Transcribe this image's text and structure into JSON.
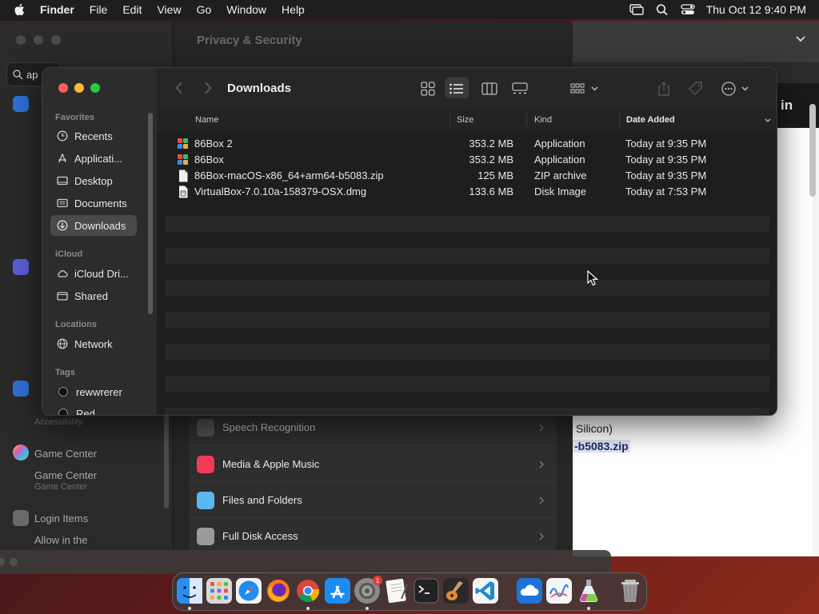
{
  "menubar": {
    "app_name": "Finder",
    "items": [
      "File",
      "Edit",
      "View",
      "Go",
      "Window",
      "Help"
    ],
    "clock": "Thu Oct 12  9:40 PM"
  },
  "settings": {
    "title": "Privacy & Security",
    "search_value": "ap",
    "sidebar": [
      {
        "label": "Game Center",
        "sub": "Game Center"
      },
      {
        "label": "Login Items",
        "sub": "Allow in the"
      }
    ],
    "accessibility_sub": "Accessibility",
    "rows": [
      "Speech Recognition",
      "Media & Apple Music",
      "Files and Folders",
      "Full Disk Access"
    ]
  },
  "browser": {
    "banner_text": "in",
    "line1": "Silicon)",
    "line2": "-b5083.zip"
  },
  "finder": {
    "title": "Downloads",
    "sections": {
      "favorites": "Favorites",
      "icloud": "iCloud",
      "locations": "Locations",
      "tags": "Tags"
    },
    "favorites": [
      "Recents",
      "Applicati...",
      "Desktop",
      "Documents",
      "Downloads"
    ],
    "icloud_items": [
      "iCloud Dri...",
      "Shared"
    ],
    "locations": [
      "Network"
    ],
    "tags": [
      "rewwrerer",
      "Red"
    ],
    "columns": {
      "name": "Name",
      "size": "Size",
      "kind": "Kind",
      "date": "Date Added"
    },
    "files": [
      {
        "name": "86Box 2",
        "size": "353.2 MB",
        "kind": "Application",
        "date": "Today at 9:35 PM"
      },
      {
        "name": "86Box",
        "size": "353.2 MB",
        "kind": "Application",
        "date": "Today at 9:35 PM"
      },
      {
        "name": "86Box-macOS-x86_64+arm64-b5083.zip",
        "size": "125 MB",
        "kind": "ZIP archive",
        "date": "Today at 9:35 PM"
      },
      {
        "name": "VirtualBox-7.0.10a-158379-OSX.dmg",
        "size": "133.6 MB",
        "kind": "Disk Image",
        "date": "Today at 7:53 PM"
      }
    ]
  },
  "dock": {
    "apps": [
      "finder-icon",
      "launchpad-icon",
      "safari-icon",
      "firefox-icon",
      "chrome-icon",
      "app-store-icon",
      "system-settings-icon",
      "textedit-icon",
      "terminal-icon",
      "garageband-icon",
      "vscode-icon",
      "cloud-app-icon",
      "freeform-icon",
      "potion-app-icon",
      "trash-icon"
    ],
    "settings_badge": "1"
  },
  "colors": {
    "close": "#fe5f57",
    "minimize": "#febc2e",
    "zoom": "#28c840",
    "selection": "#4a4a4a"
  }
}
